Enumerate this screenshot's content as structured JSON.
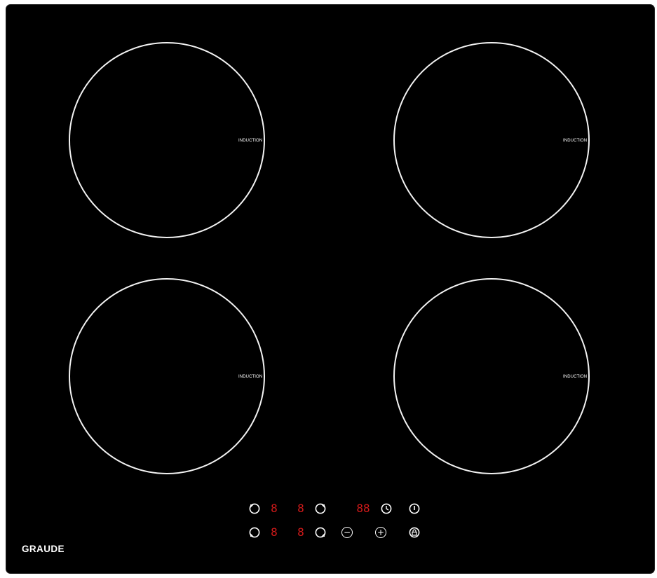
{
  "brand": "GRAUDE",
  "zones": [
    {
      "label": "INDUCTION"
    },
    {
      "label": "INDUCTION"
    },
    {
      "label": "INDUCTION"
    },
    {
      "label": "INDUCTION"
    }
  ],
  "controls": {
    "display_left_top": "8",
    "display_right_top": "8",
    "display_left_bottom": "8",
    "display_right_bottom": "8",
    "timer_display": "88",
    "minus_symbol": "−",
    "plus_symbol": "+"
  },
  "colors": {
    "glass": "#000000",
    "zone_ring": "#f2f2f2",
    "display_red": "#d21a1a"
  }
}
